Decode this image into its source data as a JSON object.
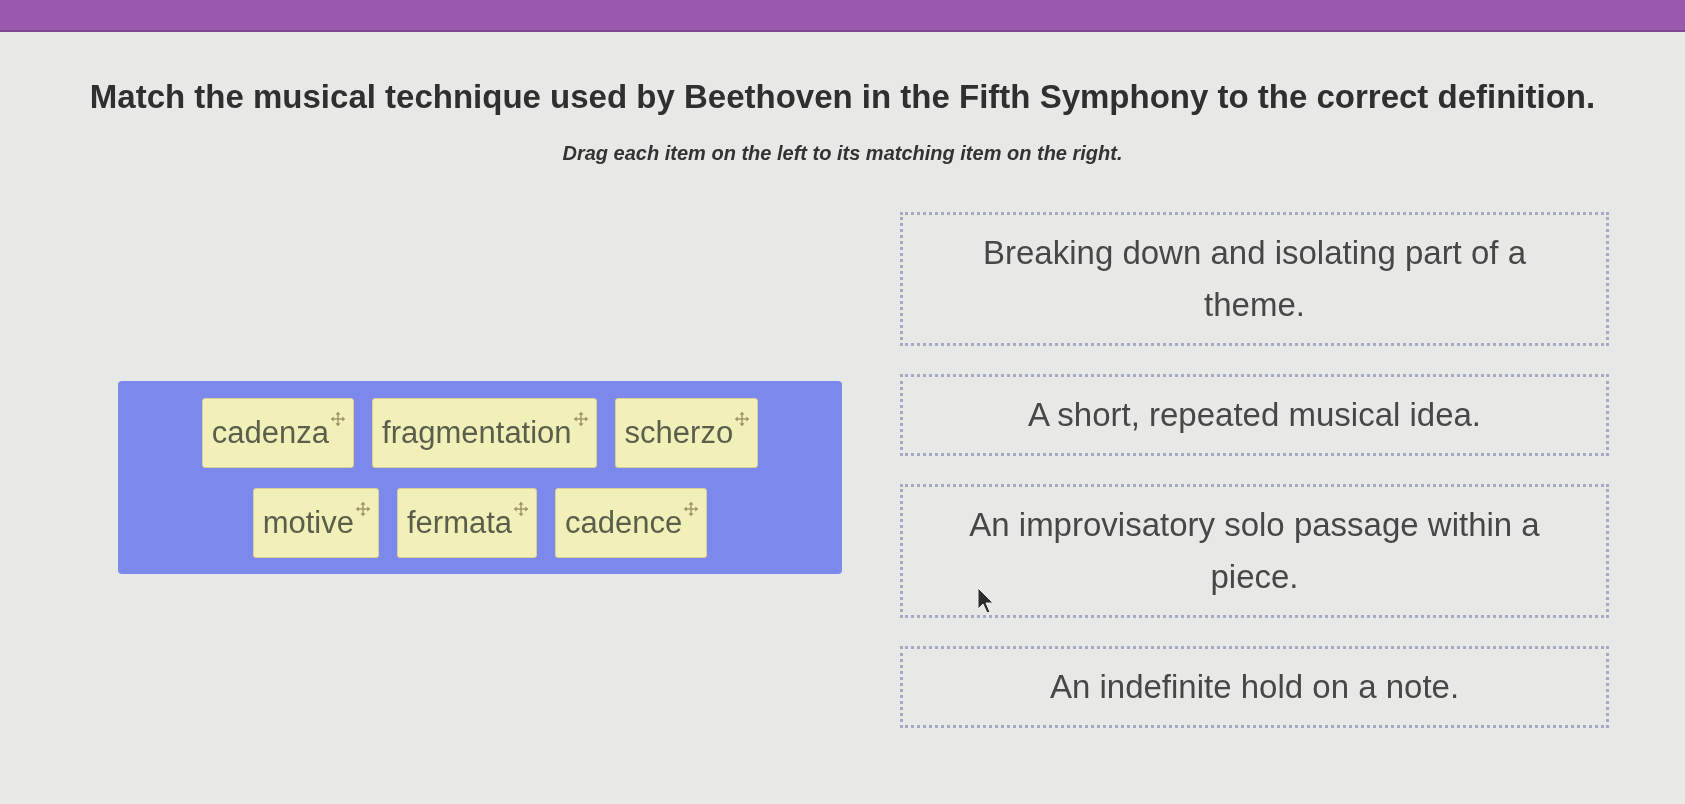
{
  "question": {
    "title": "Match the musical technique used by Beethoven in the Fifth Symphony to the correct definition.",
    "instructions": "Drag each item on the left to its matching item on the right."
  },
  "items": [
    {
      "label": "cadenza"
    },
    {
      "label": "fragmentation"
    },
    {
      "label": "scherzo"
    },
    {
      "label": "motive"
    },
    {
      "label": "fermata"
    },
    {
      "label": "cadence"
    }
  ],
  "definitions": [
    {
      "text": "Breaking down and isolating part of a theme."
    },
    {
      "text": "A short, repeated musical idea."
    },
    {
      "text": "An improvisatory solo passage within a piece."
    },
    {
      "text": "An indefinite hold on a note."
    }
  ]
}
